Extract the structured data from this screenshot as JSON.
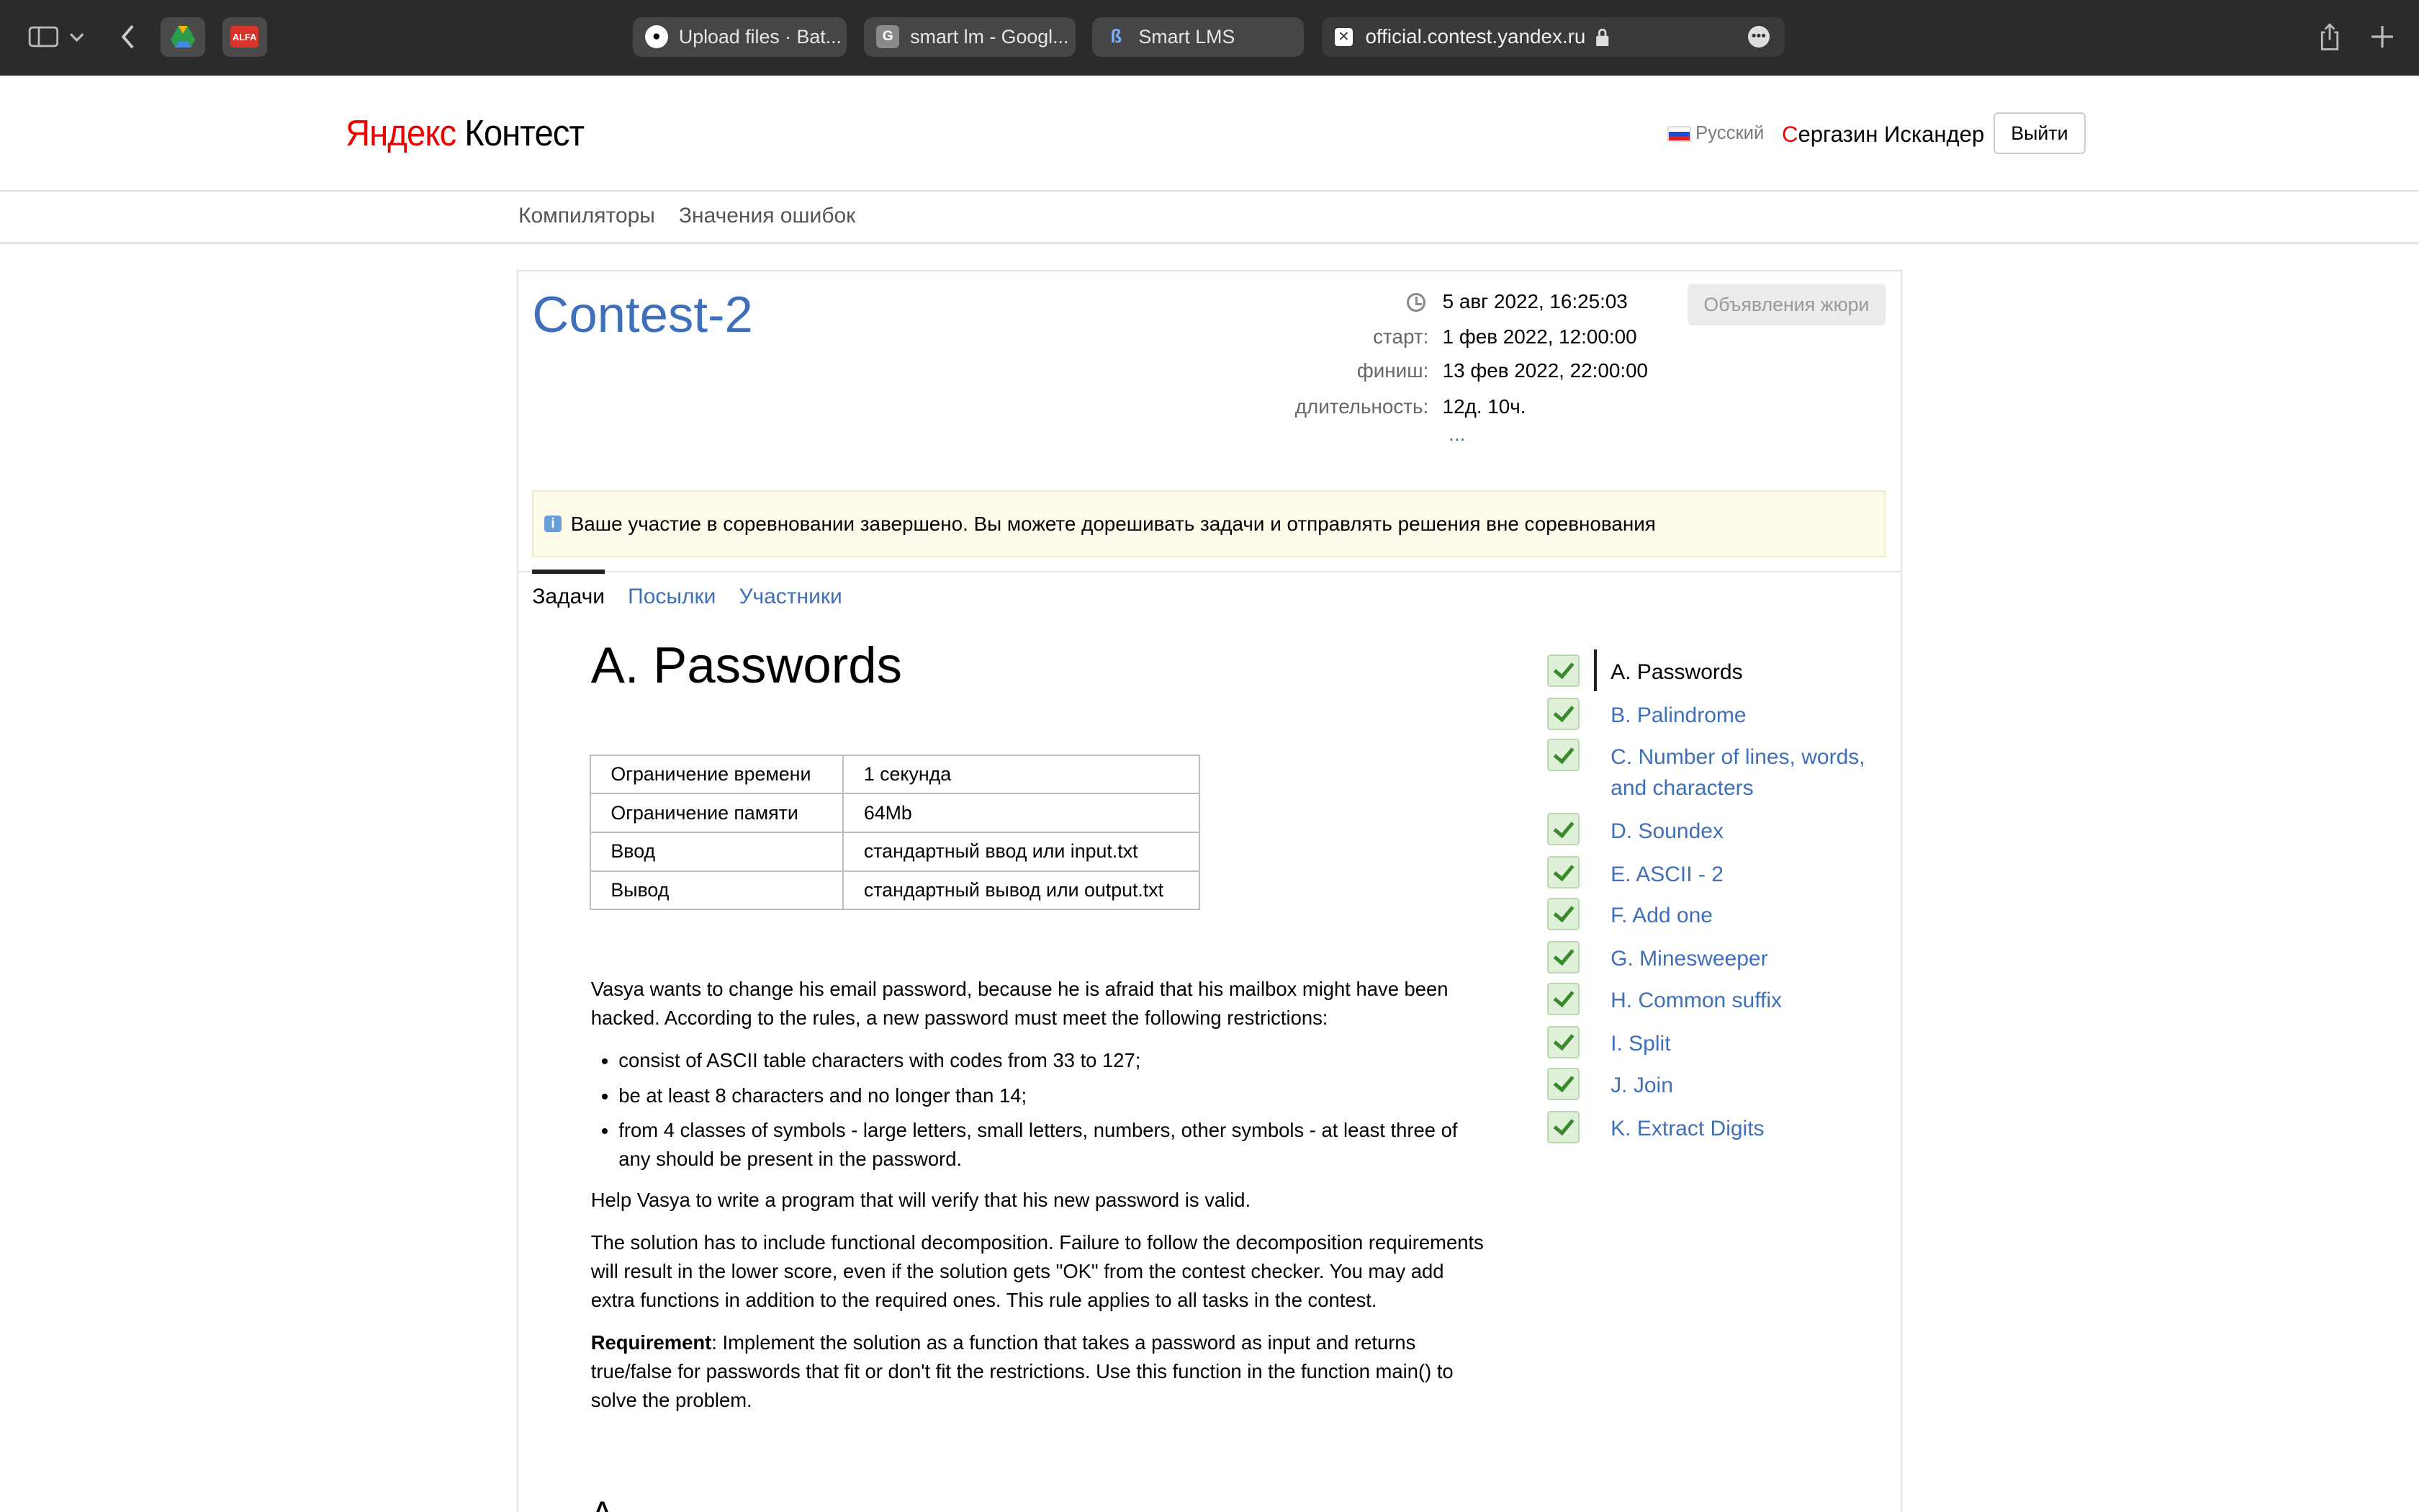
{
  "browser": {
    "tabs": [
      {
        "title": "Upload files · Bat..."
      },
      {
        "title": "smart lm - Googl..."
      },
      {
        "title": "Smart LMS"
      }
    ],
    "address": "official.contest.yandex.ru"
  },
  "header": {
    "logo_ya": "Яндекс",
    "logo_rest": " Контест",
    "language": "Русский",
    "user_first_letter": "С",
    "user_rest": "ергазин Искандер",
    "logout": "Выйти"
  },
  "nav": {
    "compilers": "Компиляторы",
    "errors": "Значения ошибок"
  },
  "contest": {
    "title": "Contest-2",
    "now": "5 авг 2022, 16:25:03",
    "start_label": "старт:",
    "start": "1 фев 2022, 12:00:00",
    "finish_label": "финиш:",
    "finish": "13 фев 2022, 22:00:00",
    "duration_label": "длительность:",
    "duration": "12д. 10ч.",
    "more": "...",
    "jury_button": "Объявления жюри",
    "notice": "Ваше участие в соревновании завершено. Вы можете дорешивать задачи и отправлять решения вне соревнования",
    "tabs": [
      "Задачи",
      "Посылки",
      "Участники"
    ]
  },
  "problem": {
    "title": "A. Passwords",
    "limits": [
      [
        "Ограничение времени",
        "1 секунда"
      ],
      [
        "Ограничение памяти",
        "64Mb"
      ],
      [
        "Ввод",
        "стандартный ввод или input.txt"
      ],
      [
        "Вывод",
        "стандартный вывод или output.txt"
      ]
    ],
    "intro": "Vasya wants to change his email password, because he is afraid that his mailbox might have been hacked. According to the rules, a new password must meet the following restrictions:",
    "bullets": [
      "consist of ASCII table characters with codes from 33 to 127;",
      "be at least 8 characters and no longer than 14;",
      "from 4 classes of symbols - large letters, small letters, numbers, other symbols - at least three of any should be present in the password."
    ],
    "help": "Help Vasya to write a program that will verify that his new password is valid.",
    "decomposition": "The solution has to include functional decomposition. Failure to follow the decomposition requirements will result in the lower score, even if the solution gets \"OK\" from the contest checker. You may add extra functions in addition to the required ones. This rule applies to all tasks in the contest.",
    "requirement_label": "Requirement",
    "requirement_text": ": Implement the solution as a function that takes a password as input and returns true/false for passwords that fit or don't fit the restrictions. Use this function in the function main() to solve the problem.",
    "next_heading_partial": "A"
  },
  "tasks": [
    {
      "name": "A. Passwords"
    },
    {
      "name": "B. Palindrome"
    },
    {
      "name": "C. Number of lines, words, and characters"
    },
    {
      "name": "D. Soundex"
    },
    {
      "name": "E. ASCII - 2"
    },
    {
      "name": "F. Add one"
    },
    {
      "name": "G. Minesweeper"
    },
    {
      "name": "H. Common suffix"
    },
    {
      "name": "I. Split"
    },
    {
      "name": "J. Join"
    },
    {
      "name": "K. Extract Digits"
    }
  ]
}
